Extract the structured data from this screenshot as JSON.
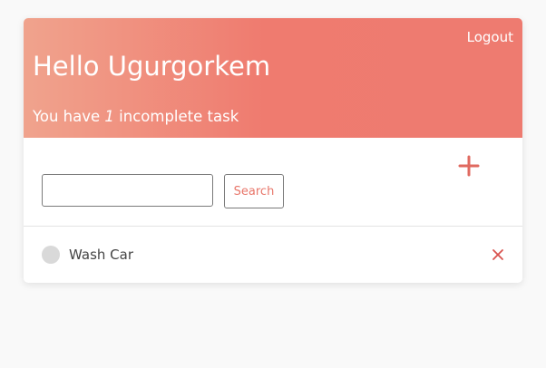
{
  "header": {
    "greeting": "Hello Ugurgorkem",
    "logout_label": "Logout",
    "subtitle_prefix": "You have ",
    "incomplete_count": "1",
    "subtitle_suffix": " incomplete task"
  },
  "toolbar": {
    "search_value": "",
    "search_placeholder": "",
    "search_label": "Search",
    "add_icon": "plus-icon"
  },
  "tasks": [
    {
      "label": "Wash Car",
      "completed": false,
      "delete_icon": "close-icon"
    }
  ],
  "colors": {
    "accent": "#ee7b70",
    "gradient_start": "#f0a38d",
    "check_inactive": "#d9d9d9",
    "delete_icon": "#d9534f"
  }
}
